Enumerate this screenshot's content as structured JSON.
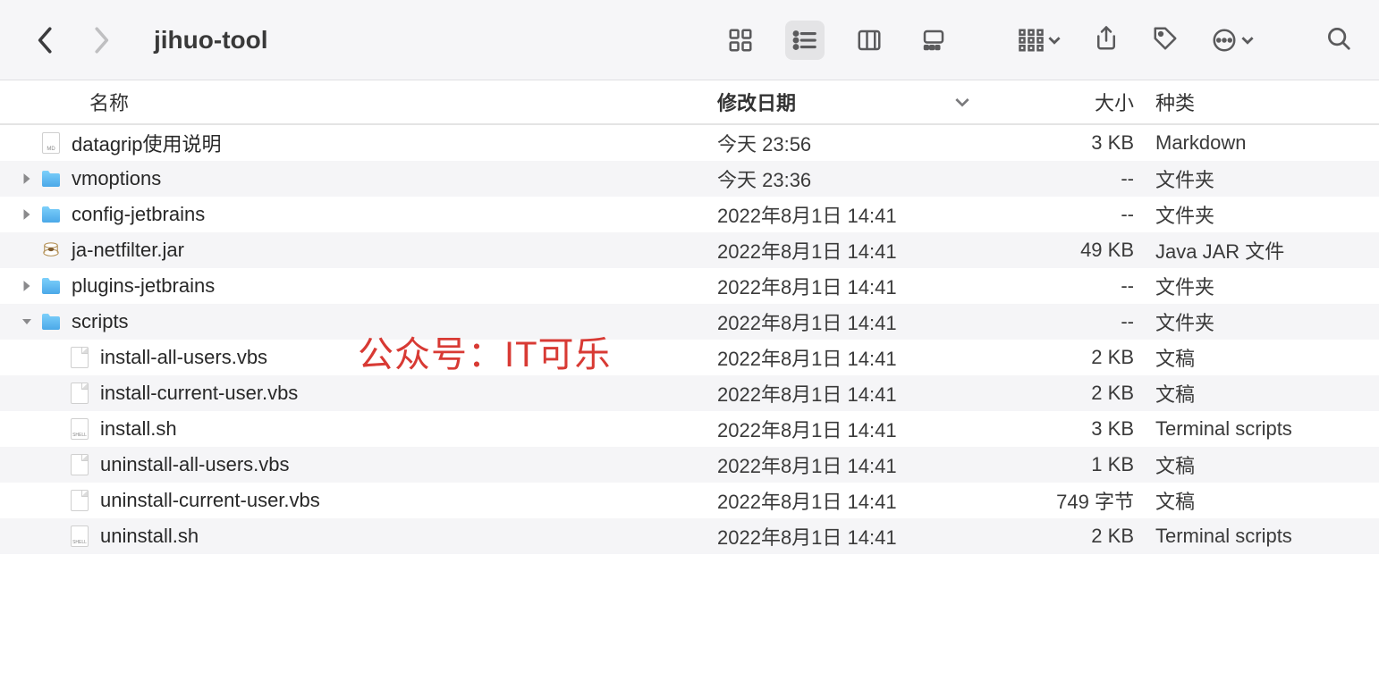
{
  "toolbar": {
    "title": "jihuo-tool"
  },
  "watermark": "公众号：IT可乐",
  "columns": {
    "name": "名称",
    "date": "修改日期",
    "size": "大小",
    "kind": "种类"
  },
  "rows": [
    {
      "indent": 0,
      "disclosure": "none",
      "icon": "md",
      "name": "datagrip使用说明",
      "date": "今天 23:56",
      "size": "3 KB",
      "kind": "Markdown",
      "alt": false
    },
    {
      "indent": 0,
      "disclosure": "closed",
      "icon": "folder",
      "name": "vmoptions",
      "date": "今天 23:36",
      "size": "--",
      "kind": "文件夹",
      "alt": true
    },
    {
      "indent": 0,
      "disclosure": "closed",
      "icon": "folder",
      "name": "config-jetbrains",
      "date": "2022年8月1日 14:41",
      "size": "--",
      "kind": "文件夹",
      "alt": false
    },
    {
      "indent": 0,
      "disclosure": "none",
      "icon": "jar",
      "name": "ja-netfilter.jar",
      "date": "2022年8月1日 14:41",
      "size": "49 KB",
      "kind": "Java JAR 文件",
      "alt": true
    },
    {
      "indent": 0,
      "disclosure": "closed",
      "icon": "folder",
      "name": "plugins-jetbrains",
      "date": "2022年8月1日 14:41",
      "size": "--",
      "kind": "文件夹",
      "alt": false
    },
    {
      "indent": 0,
      "disclosure": "open",
      "icon": "folder",
      "name": "scripts",
      "date": "2022年8月1日 14:41",
      "size": "--",
      "kind": "文件夹",
      "alt": true
    },
    {
      "indent": 1,
      "disclosure": "none",
      "icon": "doc",
      "name": "install-all-users.vbs",
      "date": "2022年8月1日 14:41",
      "size": "2 KB",
      "kind": "文稿",
      "alt": false
    },
    {
      "indent": 1,
      "disclosure": "none",
      "icon": "doc",
      "name": "install-current-user.vbs",
      "date": "2022年8月1日 14:41",
      "size": "2 KB",
      "kind": "文稿",
      "alt": true
    },
    {
      "indent": 1,
      "disclosure": "none",
      "icon": "sh",
      "name": "install.sh",
      "date": "2022年8月1日 14:41",
      "size": "3 KB",
      "kind": "Terminal scripts",
      "alt": false
    },
    {
      "indent": 1,
      "disclosure": "none",
      "icon": "doc",
      "name": "uninstall-all-users.vbs",
      "date": "2022年8月1日 14:41",
      "size": "1 KB",
      "kind": "文稿",
      "alt": true
    },
    {
      "indent": 1,
      "disclosure": "none",
      "icon": "doc",
      "name": "uninstall-current-user.vbs",
      "date": "2022年8月1日 14:41",
      "size": "749 字节",
      "kind": "文稿",
      "alt": false
    },
    {
      "indent": 1,
      "disclosure": "none",
      "icon": "sh",
      "name": "uninstall.sh",
      "date": "2022年8月1日 14:41",
      "size": "2 KB",
      "kind": "Terminal scripts",
      "alt": true
    }
  ]
}
